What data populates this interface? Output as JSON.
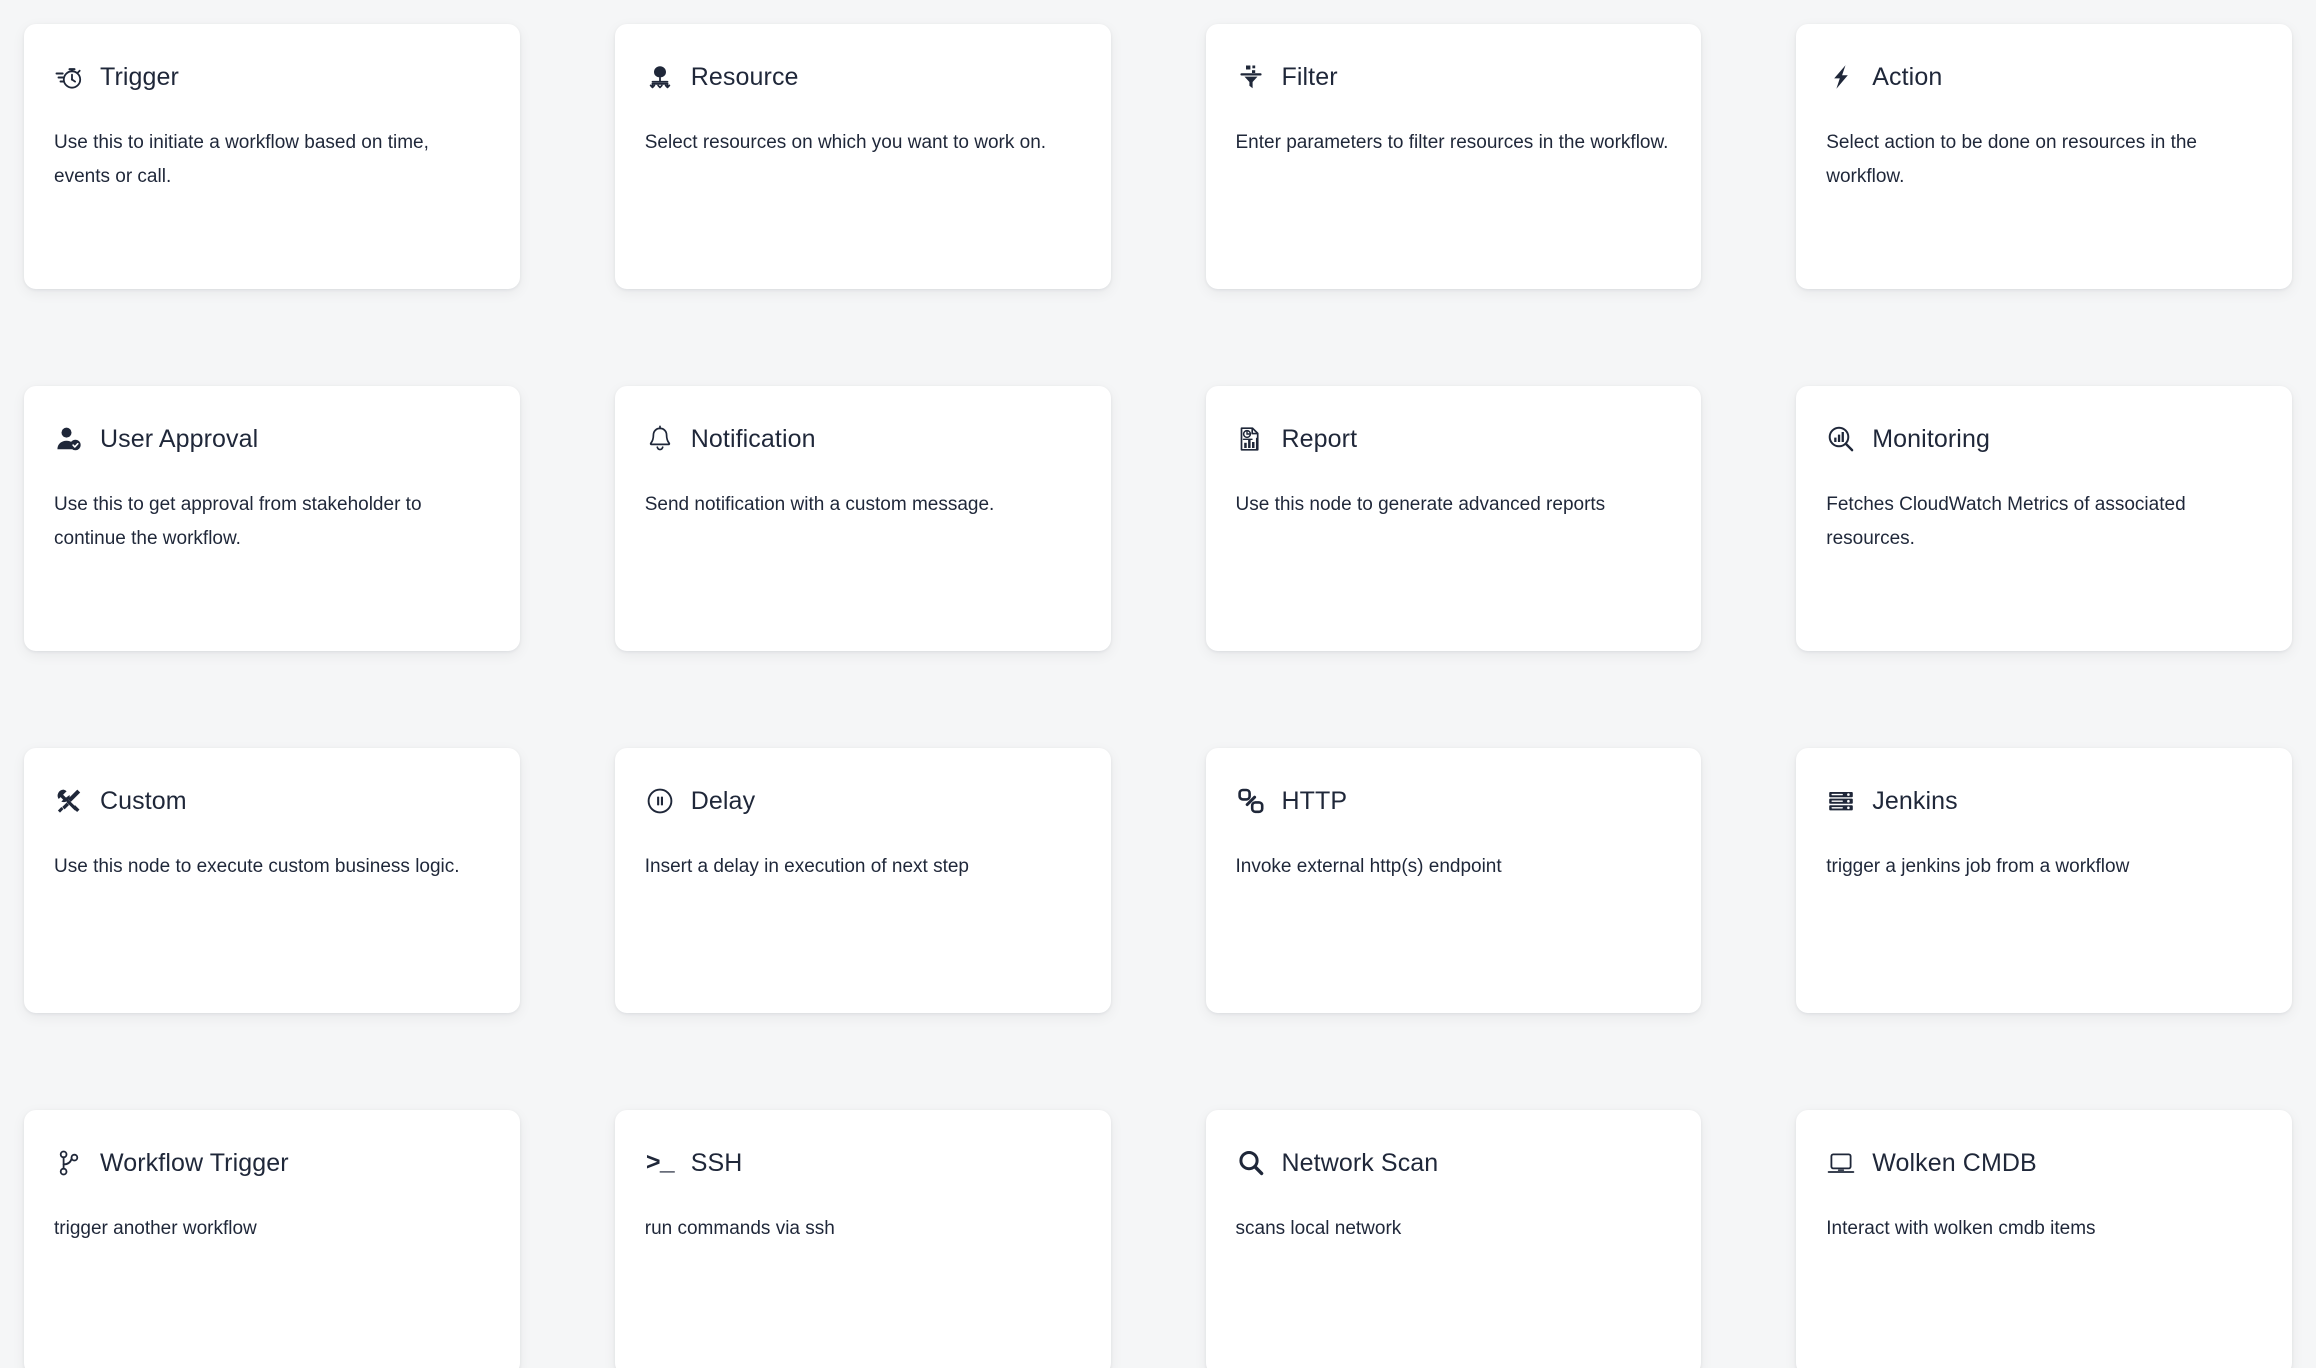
{
  "palette": {
    "columns": 4,
    "accent_color": "#1f2739",
    "card_background": "#ffffff",
    "page_background": "#f5f6f7",
    "nodes": [
      {
        "id": "trigger",
        "title": "Trigger",
        "description": "Use this to initiate a workflow based on time, events or call.",
        "icon": "stopwatch-icon"
      },
      {
        "id": "resource",
        "title": "Resource",
        "description": "Select resources on which you want to work on.",
        "icon": "resource-tree-icon"
      },
      {
        "id": "filter",
        "title": "Filter",
        "description": "Enter parameters to filter resources in the workflow.",
        "icon": "funnel-icon"
      },
      {
        "id": "action",
        "title": "Action",
        "description": "Select action to be done on resources in the workflow.",
        "icon": "lightning-bolt-icon"
      },
      {
        "id": "user-approval",
        "title": "User Approval",
        "description": "Use this to get approval from stakeholder to continue the workflow.",
        "icon": "user-check-icon"
      },
      {
        "id": "notification",
        "title": "Notification",
        "description": "Send notification with a custom message.",
        "icon": "bell-icon"
      },
      {
        "id": "report",
        "title": "Report",
        "description": "Use this node to generate advanced reports",
        "icon": "report-document-icon"
      },
      {
        "id": "monitoring",
        "title": "Monitoring",
        "description": "Fetches CloudWatch Metrics of associated resources.",
        "icon": "magnifier-chart-icon"
      },
      {
        "id": "custom",
        "title": "Custom",
        "description": "Use this node to execute custom business logic.",
        "icon": "tools-icon"
      },
      {
        "id": "delay",
        "title": "Delay",
        "description": "Insert a delay in execution of next step",
        "icon": "pause-circle-icon"
      },
      {
        "id": "http",
        "title": "HTTP",
        "description": "Invoke external http(s) endpoint",
        "icon": "link-chain-icon"
      },
      {
        "id": "jenkins",
        "title": "Jenkins",
        "description": "trigger a jenkins job from a workflow",
        "icon": "server-rack-icon"
      },
      {
        "id": "workflow-trigger",
        "title": "Workflow Trigger",
        "description": "trigger another workflow",
        "icon": "git-branch-icon"
      },
      {
        "id": "ssh",
        "title": "SSH",
        "description": "run commands via ssh",
        "icon": "terminal-prompt-icon",
        "icon_text": ">_"
      },
      {
        "id": "network-scan",
        "title": "Network Scan",
        "description": "scans local network",
        "icon": "search-icon"
      },
      {
        "id": "wolken-cmdb",
        "title": "Wolken CMDB",
        "description": "Interact with wolken cmdb items",
        "icon": "laptop-icon"
      }
    ]
  }
}
